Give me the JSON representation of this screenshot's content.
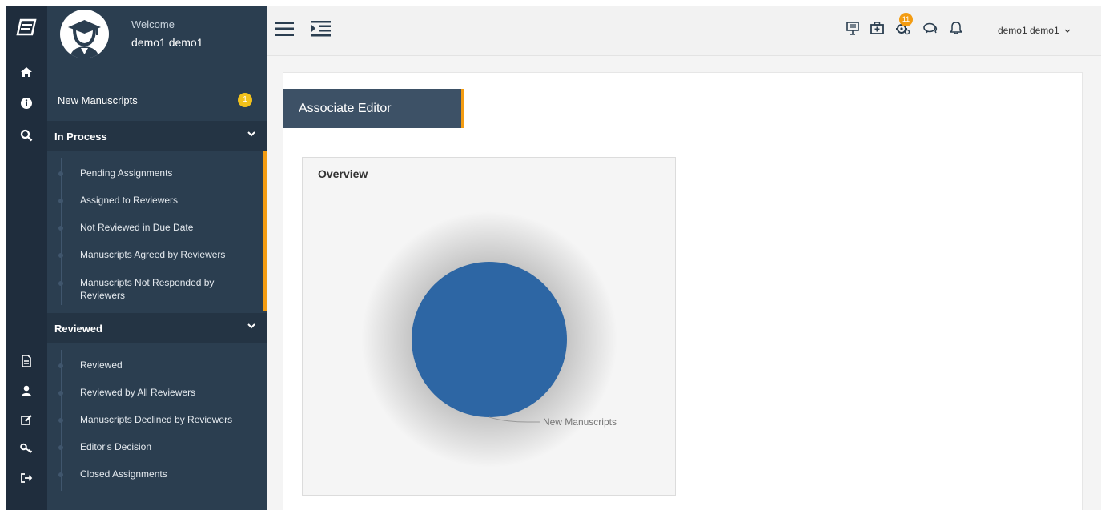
{
  "profile": {
    "welcome": "Welcome",
    "name": "demo1 demo1"
  },
  "sidebar": {
    "new_manuscripts": {
      "label": "New Manuscripts",
      "count": "1"
    },
    "in_process": {
      "label": "In Process",
      "items": [
        "Pending Assignments",
        "Assigned to Reviewers",
        "Not Reviewed in Due Date",
        "Manuscripts Agreed by Reviewers",
        "Manuscripts Not Responded by Reviewers"
      ]
    },
    "reviewed": {
      "label": "Reviewed",
      "items": [
        "Reviewed",
        "Reviewed by All Reviewers",
        "Manuscripts Declined by Reviewers",
        "Editor's Decision",
        "Closed Assignments"
      ]
    }
  },
  "rail_icons": [
    "logo-icon",
    "home-icon",
    "info-icon",
    "search-icon",
    "document-icon",
    "user-icon",
    "edit-icon",
    "key-icon",
    "logout-icon"
  ],
  "topbar": {
    "notification_count": "11",
    "user_menu": "demo1 demo1",
    "icons": [
      "menu-icon",
      "indent-icon",
      "presentation-icon",
      "medkit-icon",
      "settings-icon",
      "chat-icon",
      "bell-icon"
    ]
  },
  "page": {
    "tab_title": "Associate Editor",
    "overview_title": "Overview"
  },
  "colors": {
    "accent": "#f39c12",
    "sidebar": "#2b3e50",
    "rail": "#1f2d3d",
    "pie": "#2d66a4",
    "badge": "#f2c11b"
  },
  "chart_data": {
    "type": "pie",
    "title": "",
    "slices": [
      {
        "label": "New Manuscripts",
        "value": 1
      }
    ]
  }
}
